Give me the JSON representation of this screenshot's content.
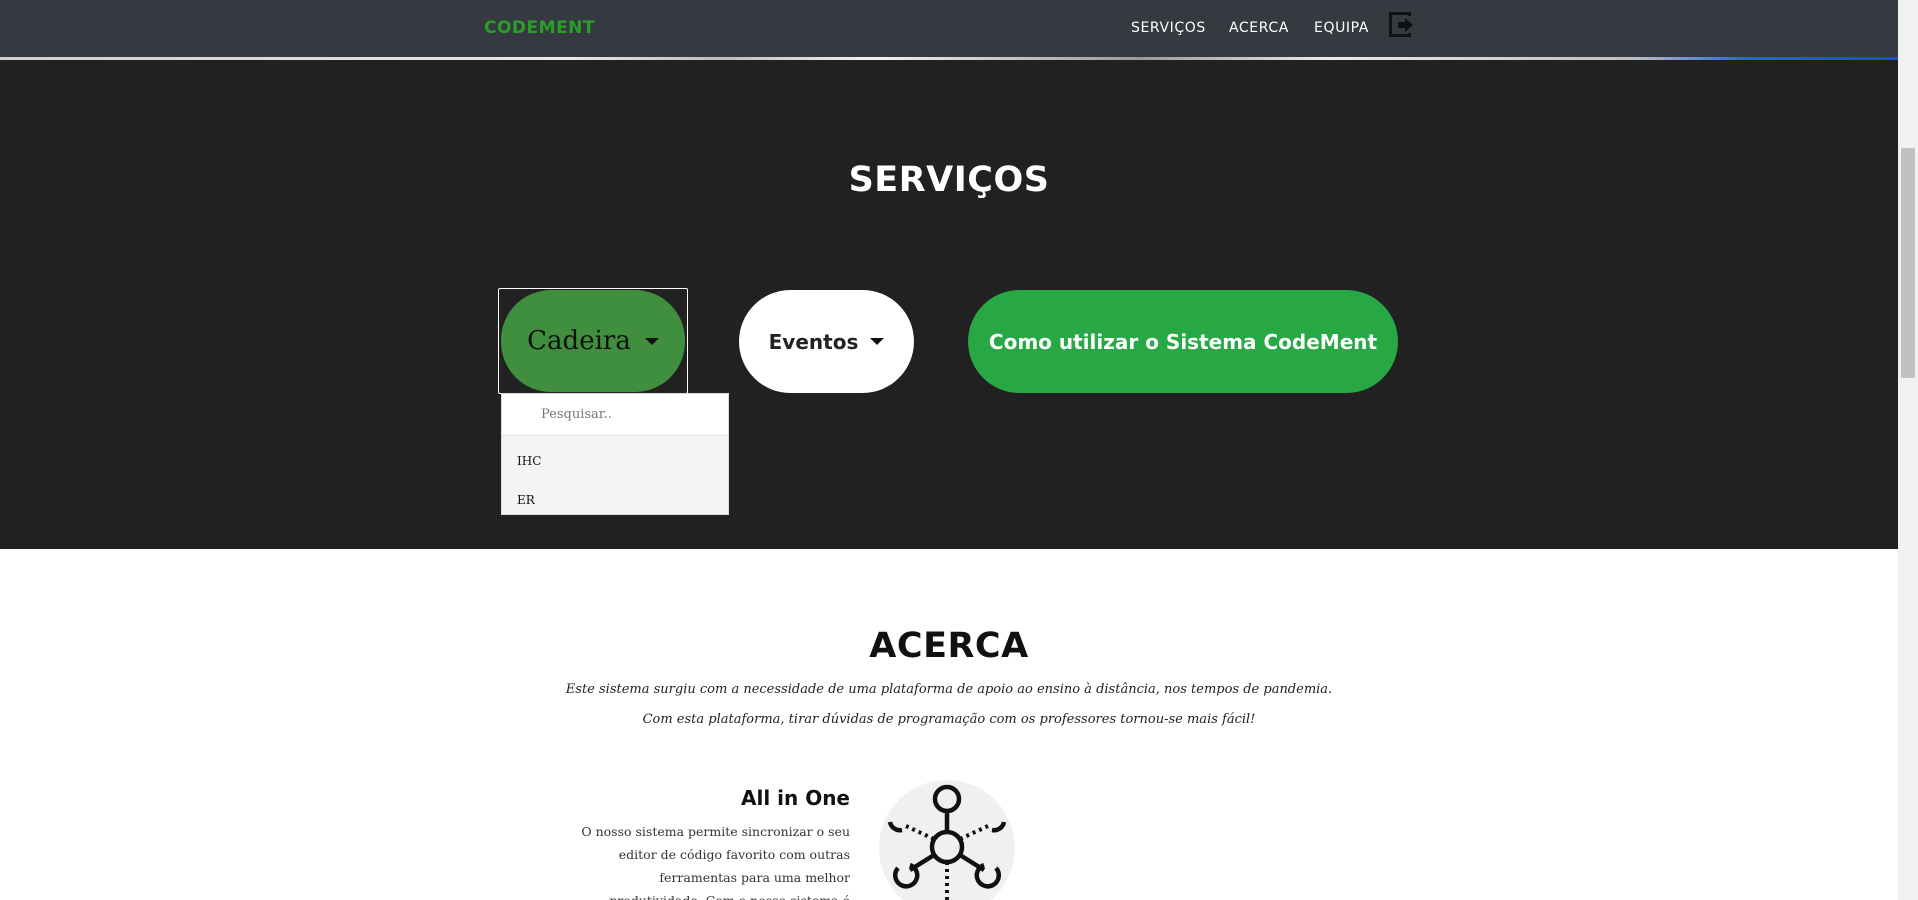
{
  "navbar": {
    "brand": "CODEMENT",
    "links": [
      "SERVIÇOS",
      "ACERCA",
      "EQUIPA"
    ],
    "logout_icon": "logout-icon"
  },
  "services": {
    "title": "SERVIÇOS",
    "cadeira_label": "Cadeira",
    "eventos_label": "Eventos",
    "como_label": "Como utilizar o Sistema CodeMent",
    "dropdown": {
      "placeholder": "Pesquisar..",
      "items": [
        "IHC",
        "ER"
      ]
    }
  },
  "acerca": {
    "title": "ACERCA",
    "p1": "Este sistema surgiu com a necessidade de uma plataforma de apoio ao ensino à distância, nos tempos de pandemia.",
    "p2": "Com esta plataforma, tirar dúvidas de programação com os professores tornou-se mais fácil!",
    "feature": {
      "title": "All in One",
      "text": "O nosso sistema permite sincronizar o seu editor de código favorito com outras ferramentas para uma melhor produtividade. Com o nosso sistema é",
      "icon": "hub-network-icon"
    }
  },
  "colors": {
    "brand": "#28a028",
    "cadeira_button": "#3f8f3f",
    "como_button": "#28a745",
    "dark_section": "#212121",
    "navbar": "#343a40"
  }
}
